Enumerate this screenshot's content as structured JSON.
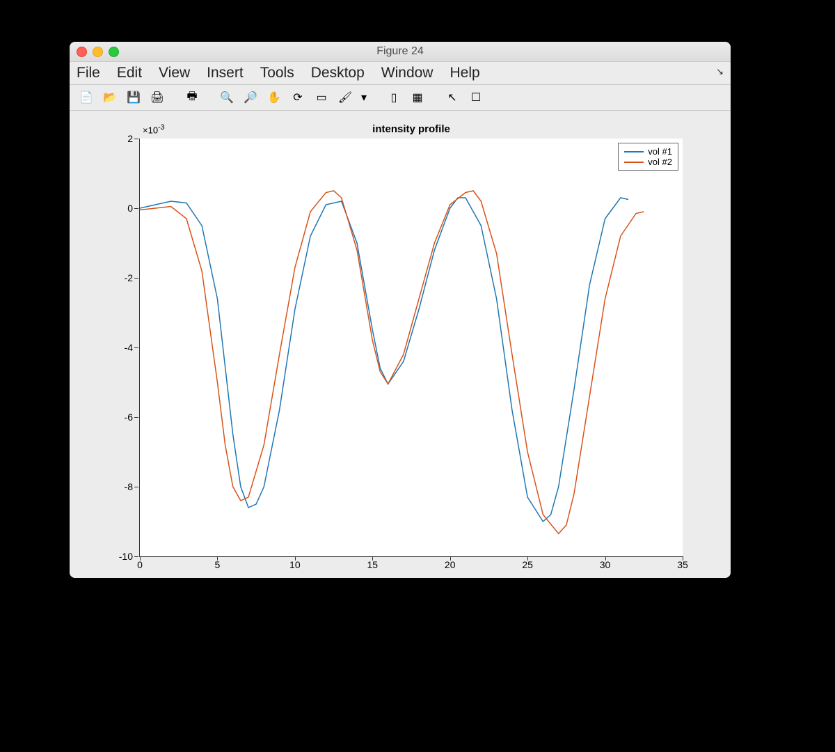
{
  "window": {
    "title": "Figure 24"
  },
  "menubar": {
    "items": [
      "File",
      "Edit",
      "View",
      "Insert",
      "Tools",
      "Desktop",
      "Window",
      "Help"
    ]
  },
  "toolbar": {
    "icons": [
      "new-figure",
      "open",
      "save",
      "print",
      "print-preview",
      "zoom-in",
      "zoom-out",
      "pan",
      "rotate",
      "data-cursor",
      "brush",
      "dropdown",
      "insert-colorbar",
      "insert-legend",
      "pointer",
      "plot-tools"
    ]
  },
  "chart_data": {
    "type": "line",
    "title": "intensity profile",
    "y_exponent_label": "×10^{-3}",
    "xlim": [
      0,
      35
    ],
    "ylim": [
      -10,
      2
    ],
    "xticks": [
      0,
      5,
      10,
      15,
      20,
      25,
      30,
      35
    ],
    "yticks": [
      -10,
      -8,
      -6,
      -4,
      -2,
      0,
      2
    ],
    "legend": [
      "vol #1",
      "vol #2"
    ],
    "colors": [
      "#1f77b4",
      "#d95319"
    ],
    "series": [
      {
        "name": "vol #1",
        "x": [
          0,
          1,
          2,
          3,
          4,
          5,
          6,
          6.5,
          7,
          7.5,
          8,
          9,
          10,
          11,
          12,
          13,
          14,
          15,
          15.5,
          16,
          17,
          18,
          19,
          20,
          20.5,
          21,
          22,
          23,
          24,
          25,
          26,
          26.5,
          27,
          28,
          29,
          30,
          31,
          31.5
        ],
        "y": [
          0,
          0.1,
          0.2,
          0.15,
          -0.5,
          -2.6,
          -6.5,
          -8.0,
          -8.6,
          -8.5,
          -8.0,
          -5.8,
          -2.9,
          -0.8,
          0.1,
          0.2,
          -1.0,
          -3.5,
          -4.6,
          -5.05,
          -4.4,
          -2.9,
          -1.2,
          0.0,
          0.3,
          0.3,
          -0.5,
          -2.6,
          -5.8,
          -8.3,
          -9.0,
          -8.8,
          -8.0,
          -5.2,
          -2.2,
          -0.3,
          0.3,
          0.25
        ]
      },
      {
        "name": "vol #2",
        "x": [
          0,
          1,
          2,
          3,
          4,
          5,
          5.5,
          6,
          6.5,
          7,
          8,
          9,
          10,
          11,
          12,
          12.5,
          13,
          14,
          15,
          15.5,
          16,
          17,
          18,
          19,
          20,
          21,
          21.5,
          22,
          23,
          24,
          25,
          26,
          27,
          27.5,
          28,
          29,
          30,
          31,
          32,
          32.5
        ],
        "y": [
          -0.05,
          0.0,
          0.05,
          -0.3,
          -1.8,
          -5.0,
          -6.8,
          -8.0,
          -8.4,
          -8.3,
          -6.8,
          -4.2,
          -1.7,
          -0.1,
          0.45,
          0.5,
          0.3,
          -1.2,
          -3.8,
          -4.7,
          -5.05,
          -4.2,
          -2.6,
          -1.0,
          0.1,
          0.45,
          0.5,
          0.2,
          -1.3,
          -4.2,
          -7.0,
          -8.8,
          -9.35,
          -9.1,
          -8.2,
          -5.4,
          -2.6,
          -0.8,
          -0.15,
          -0.1
        ]
      }
    ]
  }
}
